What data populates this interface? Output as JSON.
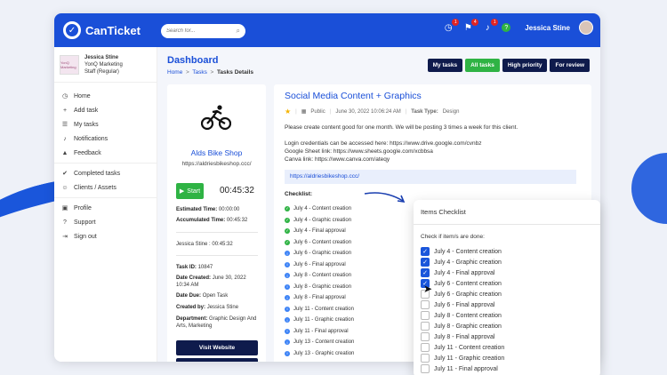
{
  "app": {
    "name": "CanTicket",
    "logo_mark": "✓"
  },
  "search": {
    "placeholder": "Search for...",
    "icon": "search-icon"
  },
  "topbar": {
    "icons": [
      {
        "name": "clock-icon",
        "glyph": "◷",
        "badge": "1"
      },
      {
        "name": "flag-icon",
        "glyph": "⚑",
        "badge": "4"
      },
      {
        "name": "bell-icon",
        "glyph": "🔔",
        "badge": "1"
      }
    ],
    "help": "?",
    "user_name": "Jessica Stine"
  },
  "company": {
    "logo_text": "YonQ Marketing",
    "name": "Jessica Stine",
    "org": "YonQ Marketing",
    "role": "Staff (Regular)"
  },
  "sidebar": {
    "groups": [
      [
        {
          "label": "Home",
          "icon": "◷"
        },
        {
          "label": "Add task",
          "icon": "+"
        },
        {
          "label": "My tasks",
          "icon": "☰"
        },
        {
          "label": "Notifications",
          "icon": "🔔"
        },
        {
          "label": "Feedback",
          "icon": "👍"
        }
      ],
      [
        {
          "label": "Completed tasks",
          "icon": "✔"
        },
        {
          "label": "Clients / Assets",
          "icon": "👥"
        }
      ],
      [
        {
          "label": "Profile",
          "icon": "▣"
        },
        {
          "label": "Support",
          "icon": "?"
        },
        {
          "label": "Sign out",
          "icon": "⇥"
        }
      ]
    ]
  },
  "page": {
    "title": "Dashboard",
    "crumbs": {
      "home": "Home",
      "tasks": "Tasks",
      "current": "Tasks Details",
      "sep": ">"
    },
    "tabs": [
      "My tasks",
      "All tasks",
      "High priority",
      "For review"
    ],
    "active_tab": "All tasks"
  },
  "client": {
    "name": "Alds Bike Shop",
    "url": "https://aldriesbikeshop.ccc/",
    "start_label": "Start",
    "timer": "00:45:32",
    "estimated_label": "Estimated Time:",
    "estimated_value": "00:00:00",
    "accumulated_label": "Accumulated Time:",
    "accumulated_value": "00:45:32",
    "log": "Jessica Stine : 00:45:32",
    "task_id_label": "Task ID:",
    "task_id": "10847",
    "created_label": "Date Created:",
    "created": "June 30, 2022 10:34 AM",
    "due_label": "Date Due:",
    "due": "Open Task",
    "created_by_label": "Created by:",
    "created_by": "Jessica Stine",
    "dept_label": "Department:",
    "dept": "Graphic Design And Arts, Marketing",
    "visit_label": "Visit Website"
  },
  "task": {
    "title": "Social Media Content + Graphics",
    "visibility": "Public",
    "date": "June 30, 2022 10:06:24 AM",
    "type_label": "Task Type:",
    "type": "Design",
    "line1": "Please create content good for one month. We will be posting 3 times a week for this client.",
    "line2": "Login credentials can be accessed here: https://www.drive.google.com/cvnbz",
    "line3": "Google Sheet link: https://www.sheets.google.com/xcbbsa",
    "line4": "Canva link: https://www.canva.com/ateqy",
    "url": "https://aldriesbikeshop.ccc/",
    "checklist_label": "Checklist:",
    "checklist": [
      {
        "label": "July 4 - Content creation",
        "done": true
      },
      {
        "label": "July 4 - Graphic creation",
        "done": true
      },
      {
        "label": "July 4 - Final approval",
        "done": true
      },
      {
        "label": "July 6 - Content creation",
        "done": true
      },
      {
        "label": "July 6 - Graphic creation",
        "done": false
      },
      {
        "label": "July 6 - Final approval",
        "done": false
      },
      {
        "label": "July 8 - Content creation",
        "done": false
      },
      {
        "label": "July 8 - Graphic creation",
        "done": false
      },
      {
        "label": "July 8 - Final approval",
        "done": false
      },
      {
        "label": "July 11 - Content creation",
        "done": false
      },
      {
        "label": "July 11 - Graphic creation",
        "done": false
      },
      {
        "label": "July 11 - Final approval",
        "done": false
      },
      {
        "label": "July 13 - Content creation",
        "done": false
      },
      {
        "label": "July 13 - Graphic creation",
        "done": false
      }
    ]
  },
  "popup": {
    "title": "Items Checklist",
    "question": "Check if item/s are done:",
    "items": [
      {
        "label": "July 4 - Content creation",
        "checked": true
      },
      {
        "label": "July 4 - Graphic creation",
        "checked": true
      },
      {
        "label": "July 4 - Final approval",
        "checked": true
      },
      {
        "label": "July 6 - Content creation",
        "checked": true
      },
      {
        "label": "July 6 - Graphic creation",
        "checked": false
      },
      {
        "label": "July 6 - Final approval",
        "checked": false
      },
      {
        "label": "July 8 - Content creation",
        "checked": false
      },
      {
        "label": "July 8 - Graphic creation",
        "checked": false
      },
      {
        "label": "July 8 - Final approval",
        "checked": false
      },
      {
        "label": "July 11 - Content creation",
        "checked": false
      },
      {
        "label": "July 11 - Graphic creation",
        "checked": false
      },
      {
        "label": "July 11 - Final approval",
        "checked": false
      }
    ]
  },
  "colors": {
    "brand": "#1a4fd8",
    "success": "#2fb344",
    "dark": "#0f1b4c",
    "danger": "#e02424"
  }
}
